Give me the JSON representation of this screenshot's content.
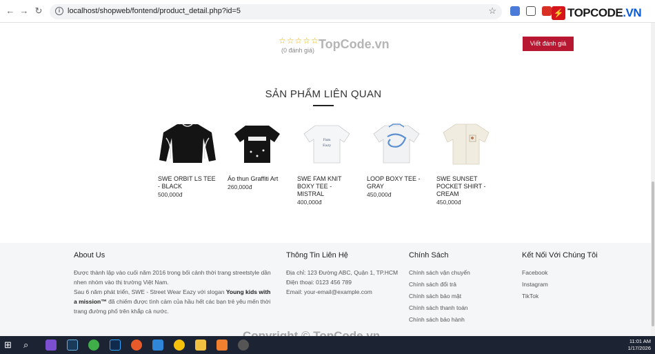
{
  "browser": {
    "url": "localhost/shopweb/fontend/product_detail.php?id=5",
    "brand": "TOPCODE",
    "brand_suffix": ".VN"
  },
  "rating": {
    "stars": "☆☆☆☆☆",
    "count_text": "(0 đánh giá)",
    "review_button": "Viết đánh giá",
    "watermark": "TopCode.vn"
  },
  "related": {
    "title": "SẢN PHẨM LIÊN QUAN",
    "products": [
      {
        "name": "SWE ORBIT LS TEE - BLACK",
        "price": "500,000đ"
      },
      {
        "name": "Áo thun Graffiti Art",
        "price": "260,000đ"
      },
      {
        "name": "SWE FAM KNIT BOXY TEE - MISTRAL",
        "price": "400,000đ"
      },
      {
        "name": "LOOP BOXY TEE - GRAY",
        "price": "450,000đ"
      },
      {
        "name": "SWE SUNSET POCKET SHIRT - CREAM",
        "price": "450,000đ"
      }
    ]
  },
  "footer": {
    "about": {
      "title": "About Us",
      "p1": "Được thành lập vào cuối năm 2016 trong bối cảnh thời trang streetstyle dần nhen nhóm vào thị trường Việt Nam.",
      "p2_start": "Sau 6 năm phát triển, SWE - Street Wear Eazy với slogan ",
      "p2_bold": "Young kids with a mission™",
      "p2_end": " đã chiếm được tình cảm của hầu hết các bạn trẻ yêu mến thời trang đường phố trên khắp cả nước."
    },
    "contact": {
      "title": "Thông Tin Liên Hệ",
      "address": "Địa chỉ: 123 Đường ABC, Quận 1, TP.HCM",
      "phone": "Điện thoại: 0123 456 789",
      "email": "Email: your-email@example.com"
    },
    "policy": {
      "title": "Chính Sách",
      "items": [
        "Chính sách vận chuyển",
        "Chính sách đổi trả",
        "Chính sách bảo mật",
        "Chính sách thanh toán",
        "Chính sách bảo hành"
      ]
    },
    "social": {
      "title": "Kết Nối Với Chúng Tôi",
      "items": [
        "Facebook",
        "Instagram",
        "TikTok"
      ]
    },
    "copyright": "Copyright © TopCode.vn"
  },
  "taskbar": {
    "time": "11:01 AM",
    "date": "1/17/2026"
  }
}
